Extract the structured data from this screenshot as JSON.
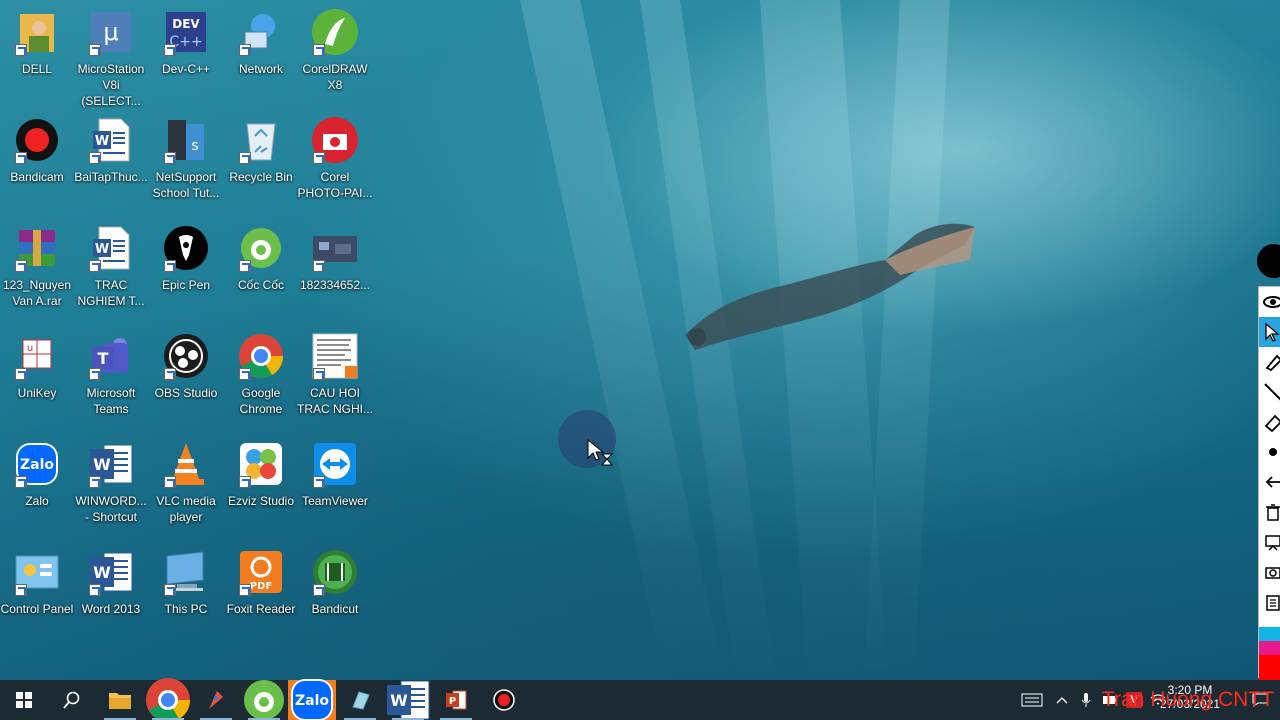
{
  "desktop_icons": [
    {
      "label": "DELL",
      "icon": "user-folder-icon"
    },
    {
      "label": "MicroStation V8i (SELECT...",
      "icon": "microstation-icon"
    },
    {
      "label": "Dev-C++",
      "icon": "devcpp-icon"
    },
    {
      "label": "Network",
      "icon": "network-icon"
    },
    {
      "label": "CorelDRAW X8",
      "icon": "coreldraw-icon"
    },
    {
      "label": "Bandicam",
      "icon": "bandicam-icon"
    },
    {
      "label": "BaiTapThuc...",
      "icon": "word-document-icon"
    },
    {
      "label": "NetSupport School Tut...",
      "icon": "netsupport-icon"
    },
    {
      "label": "Recycle Bin",
      "icon": "recycle-bin-icon"
    },
    {
      "label": "Corel PHOTO-PAI...",
      "icon": "corel-photopaint-icon"
    },
    {
      "label": "123_Nguyen Van A.rar",
      "icon": "winrar-archive-icon"
    },
    {
      "label": "TRAC NGHIEM T...",
      "icon": "word-document-icon"
    },
    {
      "label": "Epic Pen",
      "icon": "epic-pen-icon"
    },
    {
      "label": "Cốc Cốc",
      "icon": "coccoc-browser-icon"
    },
    {
      "label": "182334652...",
      "icon": "image-file-icon"
    },
    {
      "label": "UniKey",
      "icon": "unikey-icon"
    },
    {
      "label": "Microsoft Teams",
      "icon": "teams-icon"
    },
    {
      "label": "OBS Studio",
      "icon": "obs-icon"
    },
    {
      "label": "Google Chrome",
      "icon": "chrome-icon"
    },
    {
      "label": "CAU HOI TRAC NGHI...",
      "icon": "document-thumbnail-icon"
    },
    {
      "label": "Zalo",
      "icon": "zalo-icon"
    },
    {
      "label": "WINWORD... - Shortcut",
      "icon": "word-app-icon"
    },
    {
      "label": "VLC media player",
      "icon": "vlc-icon"
    },
    {
      "label": "Ezviz Studio",
      "icon": "ezviz-icon"
    },
    {
      "label": "TeamViewer",
      "icon": "teamviewer-icon"
    },
    {
      "label": "Control Panel",
      "icon": "control-panel-icon"
    },
    {
      "label": "Word 2013",
      "icon": "word-app-icon"
    },
    {
      "label": "This PC",
      "icon": "this-pc-icon"
    },
    {
      "label": "Foxit Reader",
      "icon": "foxit-reader-icon"
    },
    {
      "label": "Bandicut",
      "icon": "bandicut-icon"
    }
  ],
  "taskbar": {
    "items": [
      {
        "name": "start-button",
        "icon": "windows-logo-icon"
      },
      {
        "name": "search-button",
        "icon": "search-icon"
      },
      {
        "name": "file-explorer",
        "icon": "folder-icon"
      },
      {
        "name": "chrome",
        "icon": "chrome-icon"
      },
      {
        "name": "paint-tool",
        "icon": "pen-tool-icon"
      },
      {
        "name": "coccoc",
        "icon": "coccoc-browser-icon"
      },
      {
        "name": "zalo",
        "icon": "zalo-icon",
        "active": true
      },
      {
        "name": "notepad-tool",
        "icon": "prism-icon"
      },
      {
        "name": "word",
        "icon": "word-app-icon"
      },
      {
        "name": "powerpoint",
        "icon": "powerpoint-icon"
      },
      {
        "name": "bandicam-record",
        "icon": "record-icon"
      }
    ],
    "clock_time": "3:20 PM",
    "clock_date": "27/03/2021"
  },
  "watermark": "Tran Huong CNTT",
  "colors": {
    "taskbar_bg": "#1c2b33",
    "active_task": "#f47c20",
    "watermark": "#ff2a1a",
    "side_toolbar_selected": "#2aa3e0"
  }
}
